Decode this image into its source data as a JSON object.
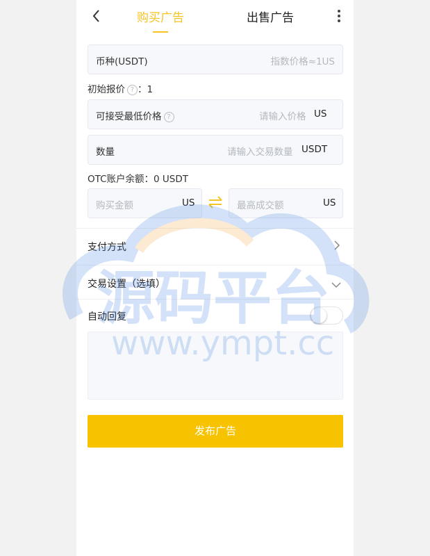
{
  "header": {
    "tab_buy": "购买广告",
    "tab_sell": "出售广告"
  },
  "currency_field": {
    "label": "币种(USDT)",
    "index_price": "指数价格≈1US"
  },
  "initial_quote": {
    "label": "初始报价",
    "colon_value": "：1"
  },
  "min_price_field": {
    "label": "可接受最低价格",
    "placeholder": "请输入价格",
    "unit": "US"
  },
  "quantity_field": {
    "label": "数量",
    "placeholder": "请输入交易数量",
    "unit": "USDT"
  },
  "otc_balance": "OTC账户余额：0 USDT",
  "buy_amount": {
    "placeholder": "购买金额",
    "unit": "US"
  },
  "max_trade": {
    "placeholder": "最高成交额",
    "unit": "US"
  },
  "payment_method": {
    "label": "支付方式"
  },
  "trade_settings": {
    "label": "交易设置（选填）"
  },
  "auto_reply": {
    "label": "自动回复",
    "enabled": false
  },
  "publish_button": "发布广告",
  "watermark": {
    "title": "源码平台",
    "url": "www.ympt.cc"
  },
  "colors": {
    "accent": "#f7c325",
    "button": "#f7c300",
    "watermark_blue": "#3d7fe0",
    "watermark_orange": "#f5a33a"
  }
}
